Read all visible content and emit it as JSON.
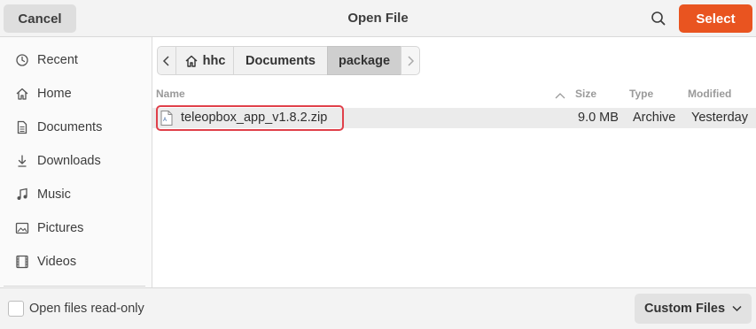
{
  "header": {
    "cancel_label": "Cancel",
    "title": "Open File",
    "select_label": "Select",
    "search_icon": "search-icon",
    "accent": "#e95420"
  },
  "sidebar": {
    "items": [
      {
        "label": "Recent",
        "icon": "clock-icon"
      },
      {
        "label": "Home",
        "icon": "home-icon"
      },
      {
        "label": "Documents",
        "icon": "document-icon"
      },
      {
        "label": "Downloads",
        "icon": "download-icon"
      },
      {
        "label": "Music",
        "icon": "music-icon"
      },
      {
        "label": "Pictures",
        "icon": "picture-icon"
      },
      {
        "label": "Videos",
        "icon": "video-icon"
      }
    ]
  },
  "pathbar": {
    "segments": [
      "hhc",
      "Documents",
      "package"
    ],
    "active": "package"
  },
  "columns": {
    "name": "Name",
    "size": "Size",
    "type": "Type",
    "modified": "Modified"
  },
  "files": [
    {
      "name": "teleopbox_app_v1.8.2.zip",
      "size": "9.0 MB",
      "type": "Archive",
      "modified": "Yesterday",
      "icon": "archive-file-icon"
    }
  ],
  "footer": {
    "readonly_label": "Open files read-only",
    "readonly_checked": false,
    "filter_label": "Custom Files"
  }
}
